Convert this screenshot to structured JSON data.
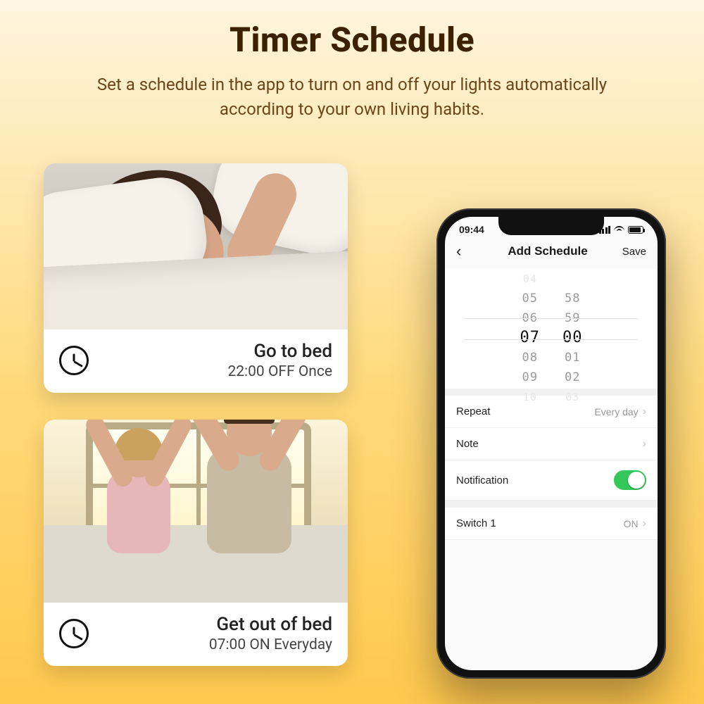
{
  "hero": {
    "title": "Timer Schedule",
    "subtitle": "Set a schedule in the app to turn on and off your lights automatically according to your own living habits."
  },
  "cards": [
    {
      "title": "Go to bed",
      "subtitle": "22:00 OFF Once"
    },
    {
      "title": "Get out of bed",
      "subtitle": "07:00 ON Everyday"
    }
  ],
  "phone": {
    "status_time": "09:44",
    "nav": {
      "title": "Add Schedule",
      "save": "Save"
    },
    "picker": {
      "hours": [
        "04",
        "05",
        "06",
        "07",
        "08",
        "09",
        "10"
      ],
      "minutes": [
        "",
        "58",
        "59",
        "00",
        "01",
        "02",
        "03"
      ]
    },
    "rows": {
      "repeat": {
        "label": "Repeat",
        "value": "Every day"
      },
      "note": {
        "label": "Note",
        "value": ""
      },
      "notification": {
        "label": "Notification"
      },
      "switch1": {
        "label": "Switch 1",
        "value": "ON"
      }
    }
  }
}
